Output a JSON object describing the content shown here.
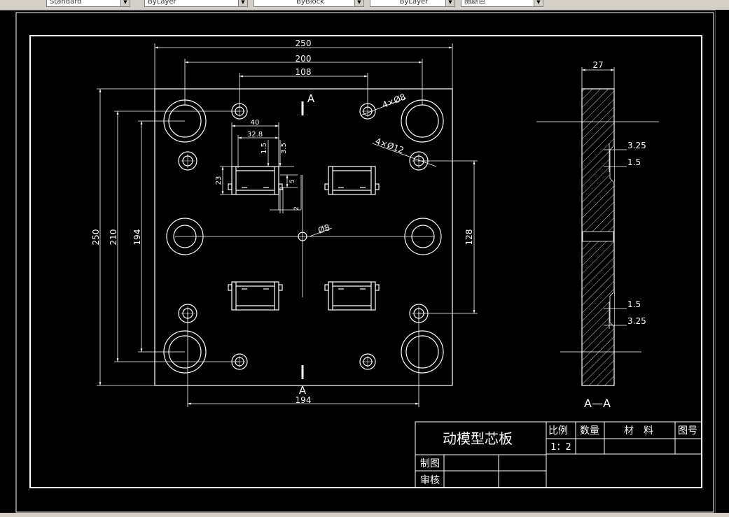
{
  "toolbar": {
    "text_style": "Standard",
    "layer": "ByLayer",
    "linetype": "ByBlock",
    "lineweight": "ByLayer",
    "color": "随颜色"
  },
  "dims": {
    "top_250": "250",
    "top_200": "200",
    "top_108": "108",
    "d_40": "40",
    "d_32_8": "32.8",
    "d_1_5_a": "1.5",
    "d_3_5": "3.5",
    "d_23": "23",
    "d_5": "5",
    "d_2": "2",
    "left_250": "250",
    "left_210": "210",
    "left_194": "194",
    "right_128": "128",
    "bottom_194": "194",
    "hole_4x8": "4×Ø8",
    "hole_4x12": "4×Ø12",
    "hole_8": "Ø8",
    "section_27": "27",
    "sec_3_25_top": "3.25",
    "sec_1_5_top": "1.5",
    "sec_1_5_bot": "1.5",
    "sec_3_25_bot": "3.25"
  },
  "labels": {
    "section_mark_top": "A",
    "section_mark_bottom": "A",
    "section_title": "A—A"
  },
  "title_block": {
    "part_name": "动模型芯板",
    "scale_header": "比例",
    "qty_header": "数量",
    "material_header": "材　料",
    "drawing_no_header": "图号",
    "scale_value": "1：2",
    "drawn_by": "制图",
    "checked_by": "审核"
  }
}
